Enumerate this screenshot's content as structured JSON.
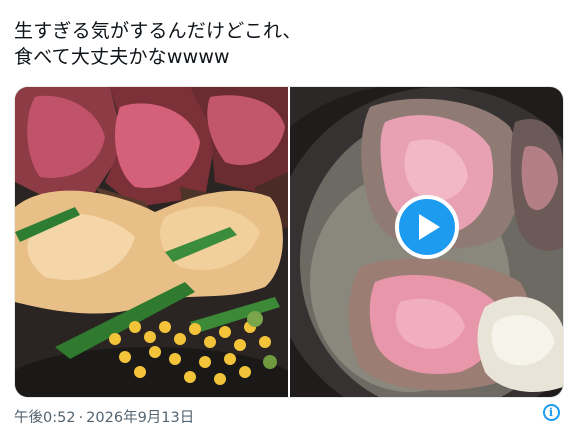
{
  "tweet": {
    "text_lines": [
      "生すぎる気がするんだけどこれ、",
      "食べて大丈夫かなwwww"
    ],
    "time": "午後0:52",
    "separator": "·",
    "date": "2026年9月13日"
  },
  "media": {
    "left_image_icon": "image",
    "right_video_icon": "play-icon"
  },
  "icons": {
    "info": "info-icon",
    "info_glyph": "i"
  },
  "colors": {
    "accent": "#1d9bf0",
    "text": "#0f1419",
    "muted": "#536471"
  }
}
